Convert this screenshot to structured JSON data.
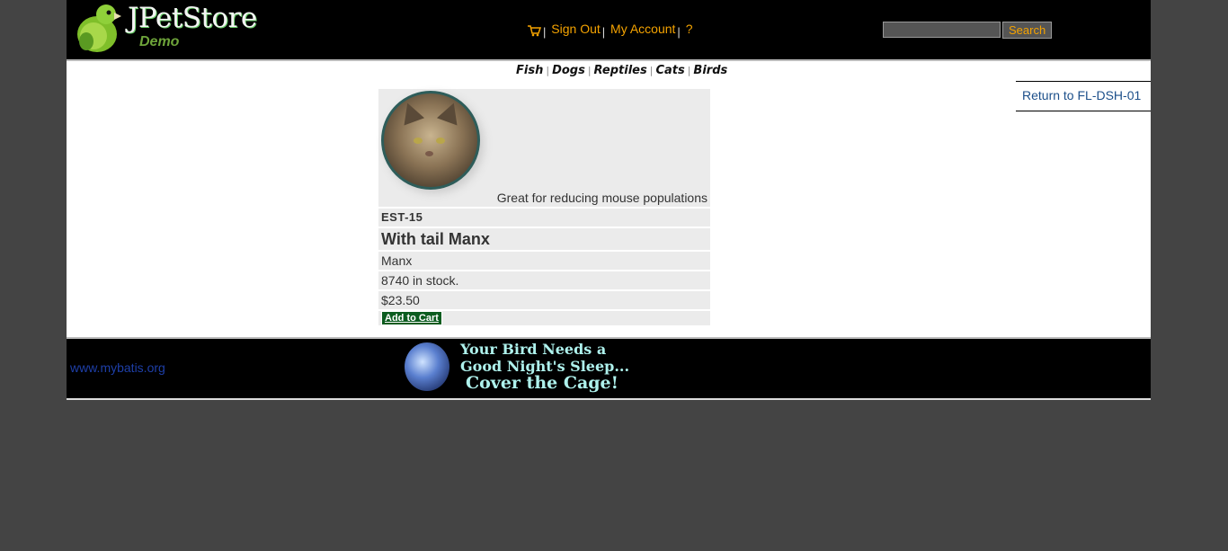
{
  "header": {
    "logo_title": "JPetStore",
    "logo_subtitle": "Demo",
    "menu": {
      "sign_out": "Sign Out",
      "my_account": "My Account",
      "help": "?",
      "separator": "|"
    },
    "search": {
      "input_value": "",
      "button_label": "Search"
    }
  },
  "quick_links": {
    "items": [
      "Fish",
      "Dogs",
      "Reptiles",
      "Cats",
      "Birds"
    ],
    "separator": "|"
  },
  "back_link": {
    "label": "Return to FL-DSH-01"
  },
  "item": {
    "description": "Great for reducing mouse populations",
    "id": "EST-15",
    "name": "With tail Manx",
    "product": "Manx",
    "stock": "8740 in stock.",
    "price": "$23.50",
    "add_to_cart_label": "Add to Cart"
  },
  "footer": {
    "link": "www.mybatis.org",
    "banner": {
      "line1": "Your Bird Needs a",
      "line2": "Good Night's Sleep...",
      "line3": "Cover the Cage!"
    }
  },
  "colors": {
    "page_background": "#444444",
    "header_background": "#000000",
    "menu_link": "#f5a300",
    "back_link": "#1c4f8a",
    "add_to_cart": "#0b5c1f",
    "footer_link": "#1e3fa8"
  }
}
